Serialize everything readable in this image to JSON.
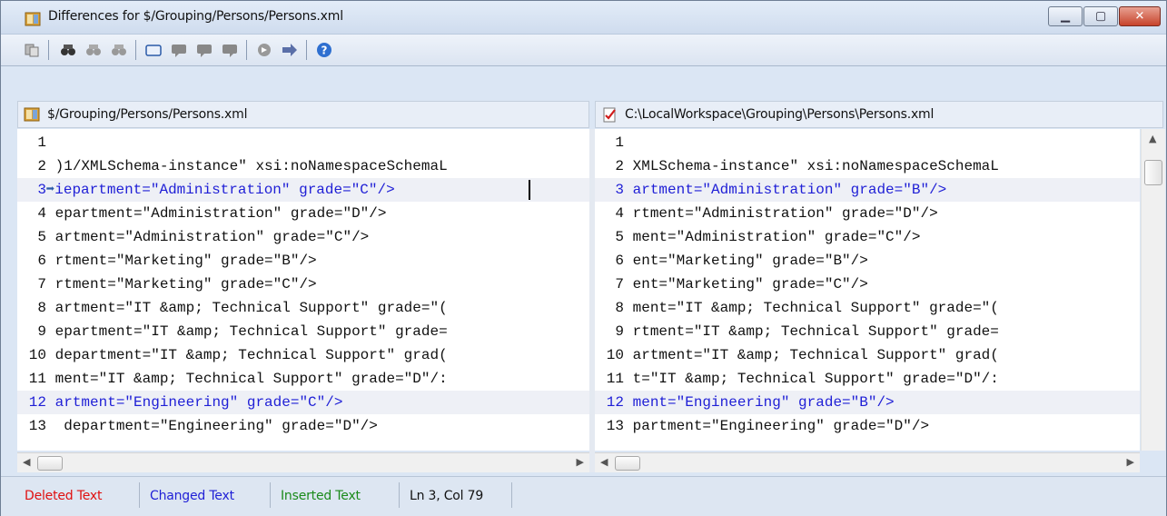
{
  "window": {
    "title": "Differences for $/Grouping/Persons/Persons.xml"
  },
  "toolbar": {
    "icons": [
      "copy-icon",
      "find-icon",
      "find-next-icon",
      "find-previous-icon",
      "comment-icon",
      "next-comment-icon",
      "previous-comment-icon",
      "delete-comment-icon",
      "merge-icon",
      "next-difference-icon",
      "help-icon"
    ]
  },
  "left_pane": {
    "title": "$/Grouping/Persons/Persons.xml",
    "lines": [
      {
        "num": "1",
        "text": "",
        "changed": false
      },
      {
        "num": "2",
        "text": ")1/XMLSchema-instance\" xsi:noNamespaceSchemaL",
        "changed": false
      },
      {
        "num": "3",
        "text": "iepartment=\"Administration\" grade=\"C\"/>",
        "changed": true,
        "marker": "➡"
      },
      {
        "num": "4",
        "text": "epartment=\"Administration\" grade=\"D\"/>",
        "changed": false
      },
      {
        "num": "5",
        "text": "artment=\"Administration\" grade=\"C\"/>",
        "changed": false
      },
      {
        "num": "6",
        "text": "rtment=\"Marketing\" grade=\"B\"/>",
        "changed": false
      },
      {
        "num": "7",
        "text": "rtment=\"Marketing\" grade=\"C\"/>",
        "changed": false
      },
      {
        "num": "8",
        "text": "artment=\"IT &amp; Technical Support\" grade=\"(",
        "changed": false
      },
      {
        "num": "9",
        "text": "epartment=\"IT &amp; Technical Support\" grade=",
        "changed": false
      },
      {
        "num": "10",
        "text": "department=\"IT &amp; Technical Support\" grad(",
        "changed": false
      },
      {
        "num": "11",
        "text": "ment=\"IT &amp; Technical Support\" grade=\"D\"/:",
        "changed": false
      },
      {
        "num": "12",
        "text": "artment=\"Engineering\" grade=\"C\"/>",
        "changed": true
      },
      {
        "num": "13",
        "text": " department=\"Engineering\" grade=\"D\"/>",
        "changed": false
      }
    ]
  },
  "right_pane": {
    "title": "C:\\LocalWorkspace\\Grouping\\Persons\\Persons.xml",
    "lines": [
      {
        "num": "1",
        "text": "",
        "changed": false
      },
      {
        "num": "2",
        "text": "XMLSchema-instance\" xsi:noNamespaceSchemaL",
        "changed": false
      },
      {
        "num": "3",
        "text": "artment=\"Administration\" grade=\"B\"/>",
        "changed": true
      },
      {
        "num": "4",
        "text": "rtment=\"Administration\" grade=\"D\"/>",
        "changed": false
      },
      {
        "num": "5",
        "text": "ment=\"Administration\" grade=\"C\"/>",
        "changed": false
      },
      {
        "num": "6",
        "text": "ent=\"Marketing\" grade=\"B\"/>",
        "changed": false
      },
      {
        "num": "7",
        "text": "ent=\"Marketing\" grade=\"C\"/>",
        "changed": false
      },
      {
        "num": "8",
        "text": "ment=\"IT &amp; Technical Support\" grade=\"(",
        "changed": false
      },
      {
        "num": "9",
        "text": "rtment=\"IT &amp; Technical Support\" grade=",
        "changed": false
      },
      {
        "num": "10",
        "text": "artment=\"IT &amp; Technical Support\" grad(",
        "changed": false
      },
      {
        "num": "11",
        "text": "t=\"IT &amp; Technical Support\" grade=\"D\"/:",
        "changed": false
      },
      {
        "num": "12",
        "text": "ment=\"Engineering\" grade=\"B\"/>",
        "changed": true
      },
      {
        "num": "13",
        "text": "partment=\"Engineering\" grade=\"D\"/>",
        "changed": false
      }
    ]
  },
  "status": {
    "deleted": "Deleted Text",
    "changed": "Changed Text",
    "inserted": "Inserted Text",
    "position": "Ln 3, Col 79",
    "colors": {
      "deleted": "#e01010",
      "changed": "#1f1fd6",
      "inserted": "#1a8a1a"
    }
  },
  "colors": {
    "changed_text": "#1f1fd6",
    "changed_bg": "#eef0f6"
  }
}
